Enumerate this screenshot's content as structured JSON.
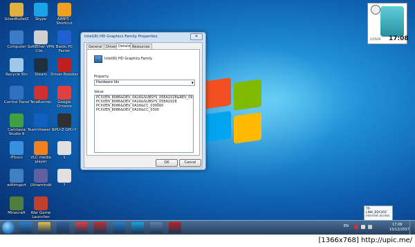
{
  "desktop": {
    "icons": [
      {
        "label": "SilverBulletZ",
        "color": "#e0b040"
      },
      {
        "label": "Skype",
        "color": "#1aa3e8"
      },
      {
        "label": "AIMP3 - Shortcut",
        "color": "#f0a020"
      },
      {
        "label": "Computer",
        "color": "#3a7cc8"
      },
      {
        "label": "SoftEther VPN Clie...",
        "color": "#d0d0d0"
      },
      {
        "label": "Baidu PC Faster",
        "color": "#2060d0"
      },
      {
        "label": "Recycle Bin",
        "color": "#a0c8e8"
      },
      {
        "label": "Steam",
        "color": "#203040"
      },
      {
        "label": "Driver Booster",
        "color": "#c02020"
      },
      {
        "label": "Control Panel",
        "color": "#3070c0"
      },
      {
        "label": "TeraRunner",
        "color": "#d03030"
      },
      {
        "label": "Google Chrome",
        "color": "#e04040"
      },
      {
        "label": "Camtasia Studio 8",
        "color": "#40a040"
      },
      {
        "label": "TeamViewer 9",
        "color": "#1060c0"
      },
      {
        "label": "GPU-Z GPU-Y",
        "color": "#303030"
      },
      {
        "label": "iFbocs",
        "color": "#3a90e0"
      },
      {
        "label": "VLC media player",
        "color": "#f08020"
      },
      {
        "label": "1",
        "color": "#e0e0e0"
      },
      {
        "label": "wifiimpprt",
        "color": "#4080c0"
      },
      {
        "label": "Ultramindd",
        "color": "#6060a0"
      },
      {
        "label": "7",
        "color": "#e0e0e0"
      },
      {
        "label": "Minecraft",
        "color": "#508040"
      },
      {
        "label": "War Game Launcher",
        "color": "#c04030"
      }
    ]
  },
  "dialog": {
    "title": "Intel(R) HD Graphics Family Properties",
    "close": "✕",
    "tabs": [
      "General",
      "Driver",
      "Details",
      "Resources"
    ],
    "device_name": "Intel(R) HD Graphics Family",
    "property_label": "Property",
    "property_value": "Hardware Ids",
    "value_label": "Value",
    "values": [
      "PCI\\VEN_8086&DEV_0A16&SUBSYS_05EA1028&REV_09",
      "PCI\\VEN_8086&DEV_0A16&SUBSYS_05EA1028",
      "PCI\\VEN_8086&DEV_0A16&CC_030000",
      "PCI\\VEN_8086&DEV_0A16&CC_0300"
    ],
    "ok": "OK",
    "cancel": "Cancel"
  },
  "gadget": {
    "time": "17:08",
    "date": "2/15/16"
  },
  "notify": {
    "line1": "TP-LINK_BDC85F",
    "line2": "Internet access"
  },
  "taskbar": {
    "lang": "EN",
    "time": "17:08",
    "date": "15/12/2557",
    "items": [
      {
        "name": "ie",
        "color": "#2a7fd0"
      },
      {
        "name": "explorer",
        "color": "#e8c050"
      },
      {
        "name": "media",
        "color": "#3060a0"
      },
      {
        "name": "chrome",
        "color": "#e04040"
      },
      {
        "name": "bag",
        "color": "#c03030"
      },
      {
        "name": "chat",
        "color": "#2080d0"
      },
      {
        "name": "skype",
        "color": "#1aa3e8"
      },
      {
        "name": "network",
        "color": "#6080b0"
      },
      {
        "name": "app",
        "color": "#c02020"
      }
    ]
  },
  "footer": "[1366x768] http://upic.me/"
}
